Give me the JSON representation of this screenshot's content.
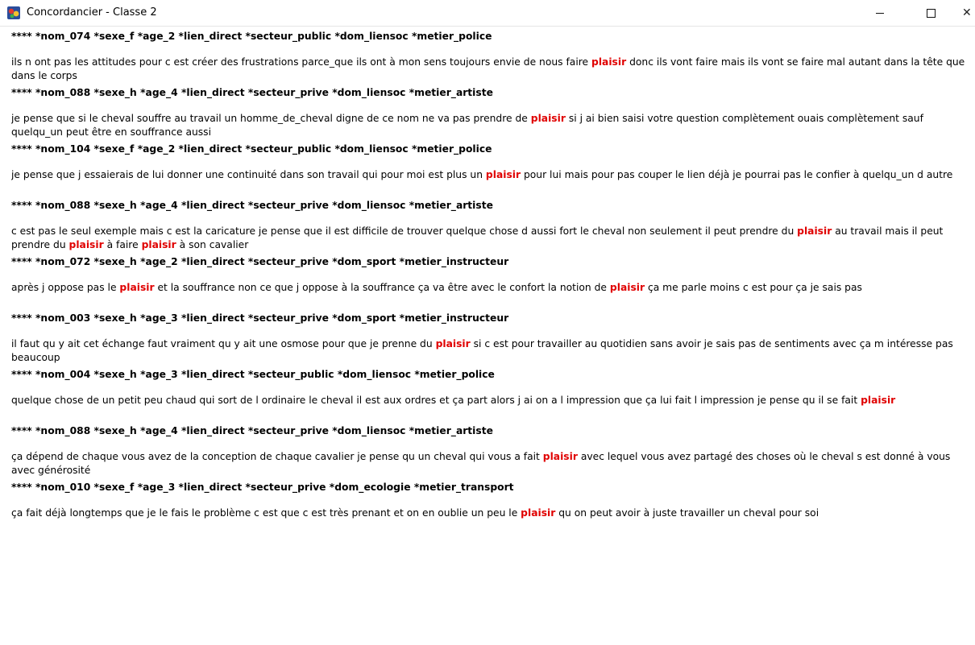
{
  "window": {
    "title": "Concordancier - Classe 2",
    "icon": "app-logo-icon",
    "controls": {
      "minimize": "—",
      "maximize": "☐",
      "close": "✕"
    }
  },
  "highlight_color": "#e00000",
  "entries": [
    {
      "header": "**** *nom_074 *sexe_f *age_2 *lien_direct *secteur_public *dom_liensoc *metier_police",
      "segments": [
        {
          "t": "ils n ont pas les attitudes pour c est créer des frustrations parce_que ils ont à mon sens toujours envie de nous faire "
        },
        {
          "t": "plaisir",
          "hl": true
        },
        {
          "t": " donc ils vont faire mais ils vont se faire mal autant dans la tête que dans le corps"
        }
      ]
    },
    {
      "header": "**** *nom_088 *sexe_h *age_4 *lien_direct *secteur_prive *dom_liensoc *metier_artiste",
      "segments": [
        {
          "t": "je pense que si le cheval souffre au travail un homme_de_cheval digne de ce nom ne va pas prendre de "
        },
        {
          "t": "plaisir",
          "hl": true
        },
        {
          "t": " si j ai bien saisi votre question complètement ouais complètement sauf quelqu_un peut être en souffrance aussi"
        }
      ]
    },
    {
      "header": "**** *nom_104 *sexe_f *age_2 *lien_direct *secteur_public *dom_liensoc *metier_police",
      "segments": [
        {
          "t": "je pense que j essaierais de lui donner une continuité dans son travail qui pour moi est plus un "
        },
        {
          "t": "plaisir",
          "hl": true
        },
        {
          "t": " pour lui mais pour pas couper le lien déjà je pourrai pas le confier à quelqu_un d autre"
        }
      ]
    },
    {
      "header": "**** *nom_088 *sexe_h *age_4 *lien_direct *secteur_prive *dom_liensoc *metier_artiste",
      "segments": [
        {
          "t": "c est pas le seul exemple mais c est la caricature je pense que il est difficile de trouver quelque chose d aussi fort le cheval non seulement il peut prendre du "
        },
        {
          "t": "plaisir",
          "hl": true
        },
        {
          "t": " au travail mais il peut prendre du "
        },
        {
          "t": "plaisir",
          "hl": true
        },
        {
          "t": " à faire "
        },
        {
          "t": "plaisir",
          "hl": true
        },
        {
          "t": " à son cavalier"
        }
      ]
    },
    {
      "header": "**** *nom_072 *sexe_h *age_2 *lien_direct *secteur_prive *dom_sport *metier_instructeur",
      "segments": [
        {
          "t": "après j oppose pas le "
        },
        {
          "t": "plaisir",
          "hl": true
        },
        {
          "t": " et la souffrance non ce que j oppose à la souffrance ça va être avec le confort la notion de "
        },
        {
          "t": "plaisir",
          "hl": true
        },
        {
          "t": " ça me parle moins c est pour ça je sais pas"
        }
      ]
    },
    {
      "header": "**** *nom_003 *sexe_h *age_3 *lien_direct *secteur_prive *dom_sport *metier_instructeur",
      "segments": [
        {
          "t": "il faut qu y ait cet échange faut vraiment qu y ait une osmose pour que je prenne du "
        },
        {
          "t": "plaisir",
          "hl": true
        },
        {
          "t": " si c est pour travailler au quotidien sans avoir je sais pas de sentiments avec ça m intéresse pas beaucoup"
        }
      ]
    },
    {
      "header": "**** *nom_004 *sexe_h *age_3 *lien_direct *secteur_public *dom_liensoc *metier_police",
      "segments": [
        {
          "t": "quelque chose de un petit peu chaud qui sort de l ordinaire le cheval il est aux ordres et ça part alors j ai on a l impression que ça lui fait l impression je pense qu il se fait "
        },
        {
          "t": "plaisir",
          "hl": true
        }
      ]
    },
    {
      "header": "**** *nom_088 *sexe_h *age_4 *lien_direct *secteur_prive *dom_liensoc *metier_artiste",
      "segments": [
        {
          "t": "ça dépend de chaque vous avez de la conception de chaque cavalier je pense qu un cheval qui vous a fait "
        },
        {
          "t": "plaisir",
          "hl": true
        },
        {
          "t": " avec lequel vous avez partagé des choses où le cheval s est donné à vous avec générosité"
        }
      ]
    },
    {
      "header": "**** *nom_010 *sexe_f *age_3 *lien_direct *secteur_prive *dom_ecologie *metier_transport",
      "segments": [
        {
          "t": "ça fait déjà longtemps que je le fais le problème c est que c est très prenant et on en oublie un peu le "
        },
        {
          "t": "plaisir",
          "hl": true
        },
        {
          "t": " qu on peut avoir à juste travailler un cheval pour soi"
        }
      ]
    }
  ]
}
